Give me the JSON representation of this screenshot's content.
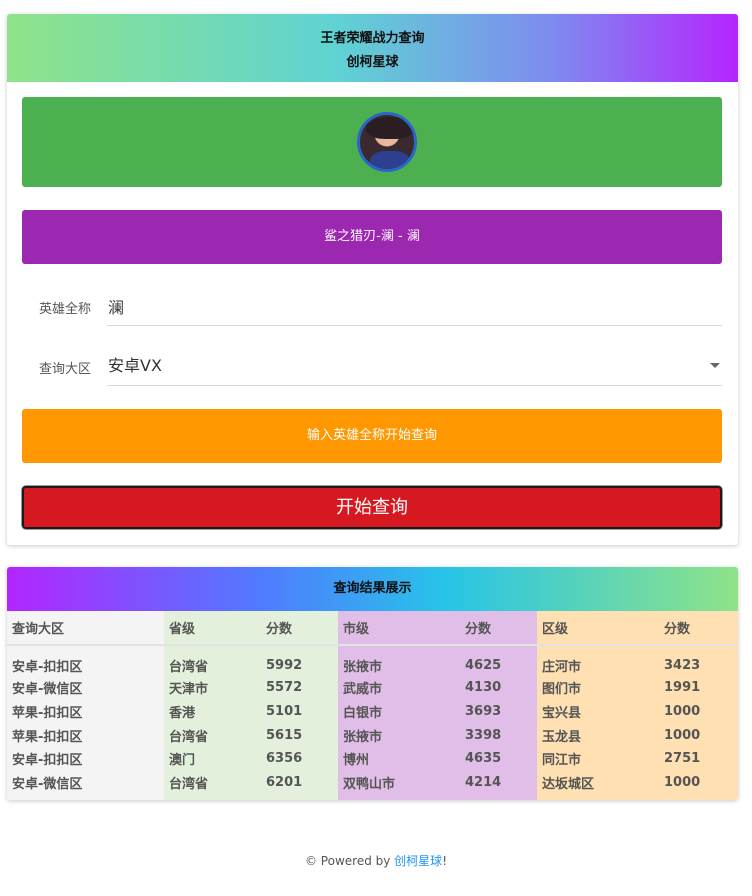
{
  "query_card": {
    "title": "王者荣耀战力查询",
    "subtitle": "创柯星球",
    "hero_display": "鲨之猎刃-澜 - 澜",
    "hero_label": "英雄全称",
    "hero_value": "澜",
    "region_label": "查询大区",
    "region_value": "安卓VX",
    "hint_text": "输入英雄全称开始查询",
    "submit_label": "开始查询"
  },
  "results": {
    "title": "查询结果展示",
    "columns": [
      "查询大区",
      "省级",
      "分数",
      "市级",
      "分数",
      "区级",
      "分数"
    ],
    "rows": [
      [
        "安卓-扣扣区",
        "台湾省",
        "5992",
        "张掖市",
        "4625",
        "庄河市",
        "3423"
      ],
      [
        "安卓-微信区",
        "天津市",
        "5572",
        "武威市",
        "4130",
        "图们市",
        "1991"
      ],
      [
        "苹果-扣扣区",
        "香港",
        "5101",
        "白银市",
        "3693",
        "宝兴县",
        "1000"
      ],
      [
        "苹果-扣扣区",
        "台湾省",
        "5615",
        "张掖市",
        "3398",
        "玉龙县",
        "1000"
      ],
      [
        "安卓-扣扣区",
        "澳门",
        "6356",
        "博州",
        "4635",
        "同江市",
        "2751"
      ],
      [
        "安卓-微信区",
        "台湾省",
        "6201",
        "双鸭山市",
        "4214",
        "达坂城区",
        "1000"
      ]
    ]
  },
  "footer": {
    "prefix": "© Powered by ",
    "link": "创柯星球",
    "suffix": "!"
  }
}
